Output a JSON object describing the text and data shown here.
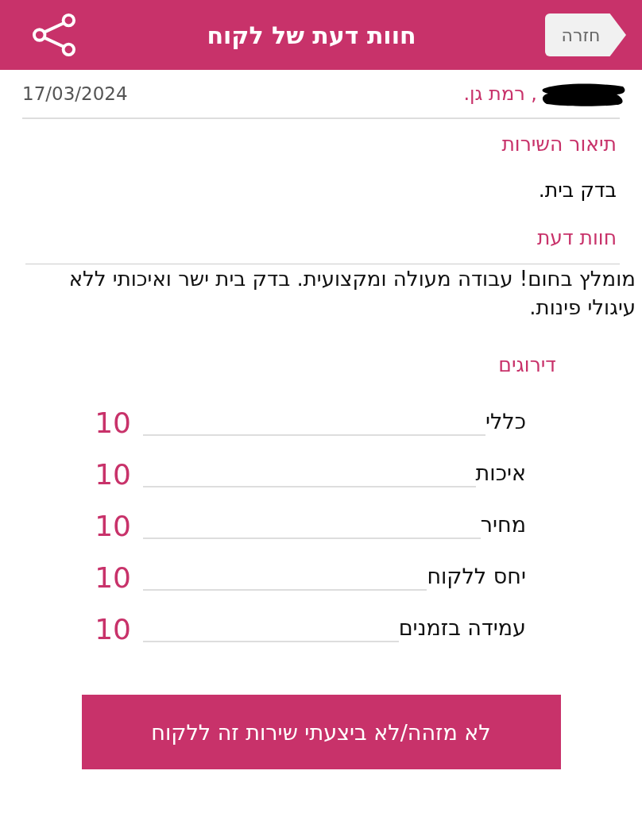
{
  "header": {
    "back_button": "חזרה",
    "title": "חוות דעת של לקוח"
  },
  "customer": {
    "location": ", רמת גן.",
    "redacted": true,
    "date": "17/03/2024"
  },
  "service": {
    "heading": "תיאור השירות",
    "text": "בדק בית."
  },
  "review": {
    "heading": "חוות דעת",
    "text": "מומלץ בחום! עבודה מעולה ומקצועית. בדק בית ישר ואיכותי ללא עיגולי פינות."
  },
  "ratings": {
    "heading": "דירוגים",
    "items": [
      {
        "label": "כללי",
        "score": "10"
      },
      {
        "label": "איכות",
        "score": "10"
      },
      {
        "label": "מחיר",
        "score": "10"
      },
      {
        "label": "יחס ללקוח",
        "score": "10"
      },
      {
        "label": "עמידה בזמנים",
        "score": "10"
      }
    ]
  },
  "report_button": "לא מזהה/לא ביצעתי שירות זה ללקוח"
}
